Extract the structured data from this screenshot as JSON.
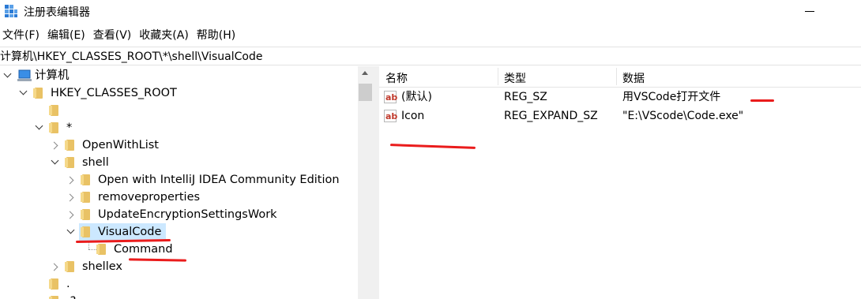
{
  "window": {
    "title": "注册表编辑器",
    "app_icon": "registry-icon"
  },
  "menu": [
    {
      "label": "文件(F)"
    },
    {
      "label": "编辑(E)"
    },
    {
      "label": "查看(V)"
    },
    {
      "label": "收藏夹(A)"
    },
    {
      "label": "帮助(H)"
    }
  ],
  "address": "计算机\\HKEY_CLASSES_ROOT\\*\\shell\\VisualCode",
  "tree": {
    "root": "计算机",
    "hkcr": "HKEY_CLASSES_ROOT",
    "star": "*",
    "openwithlist": "OpenWithList",
    "shell": "shell",
    "intellij": "Open with IntelliJ IDEA Community Edition",
    "removeproperties": "removeproperties",
    "updateenc": "UpdateEncryptionSettingsWork",
    "visualcode": "VisualCode",
    "command": "Command",
    "shellex": "shellex",
    "dot": ".",
    "dotq": ".?"
  },
  "values": {
    "columns": {
      "name": "名称",
      "type": "类型",
      "data": "数据"
    },
    "rows": [
      {
        "name": "(默认)",
        "type": "REG_SZ",
        "data": "用VSCode打开文件"
      },
      {
        "name": "Icon",
        "type": "REG_EXPAND_SZ",
        "data": "\"E:\\VScode\\Code.exe\""
      }
    ]
  },
  "colors": {
    "selection": "#cce8ff",
    "annotation": "#ea1c1c",
    "folder": "#e9c265"
  }
}
